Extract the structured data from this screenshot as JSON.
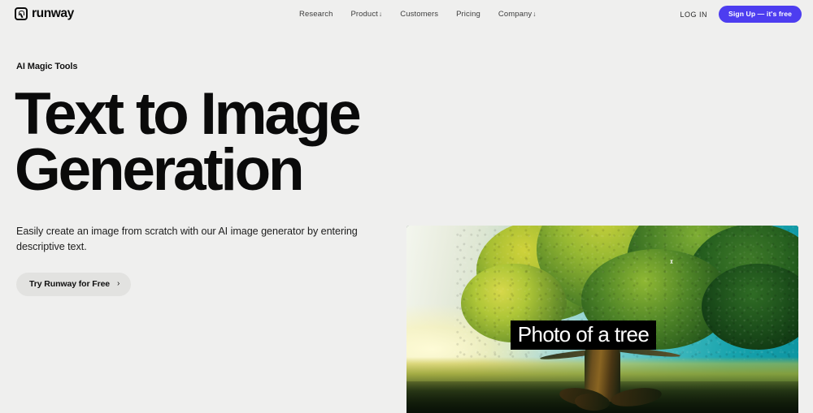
{
  "header": {
    "brand": {
      "name": "runway",
      "logo_icon": "runway-logo-icon"
    },
    "nav": [
      {
        "label": "Research",
        "caret": ""
      },
      {
        "label": "Product",
        "caret": "↓"
      },
      {
        "label": "Customers",
        "caret": ""
      },
      {
        "label": "Pricing",
        "caret": ""
      },
      {
        "label": "Company",
        "caret": "↓"
      }
    ],
    "login_label": "LOG IN",
    "signup_label": "Sign Up — it's free",
    "signup_color": "#4d3df0"
  },
  "hero": {
    "eyebrow": "AI Magic Tools",
    "headline": "Text to Image Generation",
    "subtext": "Easily create an image from scratch with our AI image generator by entering descriptive text.",
    "cta_label": "Try Runway for Free",
    "cta_chevron": "›"
  },
  "figure": {
    "alt": "Generated photo of a large tree on a field at sunset",
    "caption": "Photo of a tree",
    "caption_bg": "#000000",
    "caption_color": "#ffffff"
  },
  "theme": {
    "page_bg": "#efefee",
    "text": "#0a0a0a",
    "muted_text": "#3e3e3e",
    "cta_bg": "#e2e2e0"
  }
}
